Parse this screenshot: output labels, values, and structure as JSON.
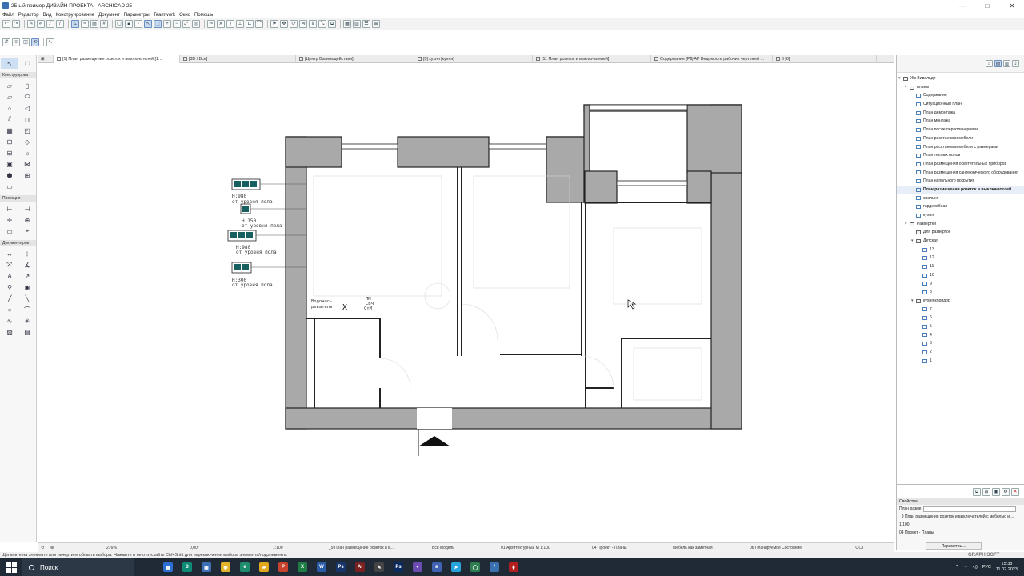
{
  "window": {
    "title": "25-ый пример ДИЗАЙН ПРОЕКТА - ARCHICAD 25",
    "minimize": "—",
    "maximize": "□",
    "close": "✕"
  },
  "menu": [
    "Файл",
    "Редактор",
    "Вид",
    "Конструирование",
    "Документ",
    "Параметры",
    "Teamwork",
    "Окно",
    "Помощь"
  ],
  "toolbox": {
    "section_design": "Конструирова",
    "section_view": "Проекция",
    "section_docs": "Документиров"
  },
  "tabs": [
    "[1] План размещения розеток и выключателей [1...",
    "[3D / Все]",
    "[Центр Взаимодействия]",
    "[0] кухня [кухня]",
    "[11 План розеток и выключателей]",
    "Содержание [РД-АР Ведомость рабочих чертежей ...",
    "6 [6]"
  ],
  "plan": {
    "socket_labels": [
      {
        "h": "H:980",
        "sub": "от уровня пола"
      },
      {
        "h": "H:150",
        "sub": "от уровня пола"
      },
      {
        "h": "H:980",
        "sub": "от уровня пола"
      },
      {
        "h": "H:300",
        "sub": "от уровня пола"
      }
    ],
    "heater_line1": "Водонаг-",
    "heater_line2": "реватель",
    "heater_mark": "X",
    "appliance_line1": "ПМ",
    "appliance_line2": "СВЧ",
    "appliance_line3": "СтМ"
  },
  "navigator": {
    "items": [
      {
        "label": "Жк Вивальди",
        "level": 0,
        "type": "root",
        "twisty": "▾"
      },
      {
        "label": "планы",
        "level": 1,
        "type": "folder",
        "twisty": "▾"
      },
      {
        "label": "Содержание",
        "level": 2,
        "type": "sheet"
      },
      {
        "label": "Ситуационный план",
        "level": 2,
        "type": "sheet"
      },
      {
        "label": "План демонтажа",
        "level": 2,
        "type": "sheet"
      },
      {
        "label": "План монтажа",
        "level": 2,
        "type": "sheet"
      },
      {
        "label": "План после перепланировки",
        "level": 2,
        "type": "sheet"
      },
      {
        "label": "План расстановки мебели",
        "level": 2,
        "type": "sheet"
      },
      {
        "label": "План расстановки мебели с размерами",
        "level": 2,
        "type": "sheet"
      },
      {
        "label": "План теплых полов",
        "level": 2,
        "type": "sheet"
      },
      {
        "label": "План размещения осветительных приборов",
        "level": 2,
        "type": "sheet"
      },
      {
        "label": "План размещения сантехнического оборудования",
        "level": 2,
        "type": "sheet"
      },
      {
        "label": "План напольного покрытия",
        "level": 2,
        "type": "sheet"
      },
      {
        "label": "План размещения розеток и выключателей",
        "level": 2,
        "type": "sheet",
        "selected": true
      },
      {
        "label": "спальня",
        "level": 2,
        "type": "sheet"
      },
      {
        "label": "гардеробная",
        "level": 2,
        "type": "sheet"
      },
      {
        "label": "кухня",
        "level": 2,
        "type": "sheet"
      },
      {
        "label": "Развертки",
        "level": 1,
        "type": "folder",
        "twisty": "▾"
      },
      {
        "label": "Для разверток",
        "level": 2,
        "type": "folder"
      },
      {
        "label": "Детская",
        "level": 2,
        "type": "folder",
        "twisty": "▾"
      },
      {
        "label": "13",
        "level": 3,
        "type": "sheet"
      },
      {
        "label": "12",
        "level": 3,
        "type": "sheet"
      },
      {
        "label": "11",
        "level": 3,
        "type": "sheet"
      },
      {
        "label": "10",
        "level": 3,
        "type": "sheet"
      },
      {
        "label": "9",
        "level": 3,
        "type": "sheet"
      },
      {
        "label": "8",
        "level": 3,
        "type": "sheet"
      },
      {
        "label": "кухня коридор",
        "level": 2,
        "type": "folder",
        "twisty": "▾"
      },
      {
        "label": "7",
        "level": 3,
        "type": "sheet"
      },
      {
        "label": "6",
        "level": 3,
        "type": "sheet"
      },
      {
        "label": "5",
        "level": 3,
        "type": "sheet"
      },
      {
        "label": "4",
        "level": 3,
        "type": "sheet"
      },
      {
        "label": "3",
        "level": 3,
        "type": "sheet"
      },
      {
        "label": "2",
        "level": 3,
        "type": "sheet"
      },
      {
        "label": "1",
        "level": 3,
        "type": "sheet"
      }
    ]
  },
  "properties": {
    "header": "Свойства",
    "field_label": "План разме",
    "field_value": "",
    "row1": "_9 План размещения розеток и выключателей с мебелью и ...",
    "row2": "1:100",
    "row3": "04 Проект - Планы",
    "button": "Параметры..."
  },
  "quick_options": {
    "zoom": "276%",
    "angle": "0,00°",
    "scale": "1:100",
    "view": "_9 План размещение розеток и в...",
    "model": "Вся Модель",
    "pen_set": "01 Архитектурный М 1:100",
    "model_view": "04 Проект - Планы",
    "override": "Мебель как заметная",
    "renovation": "06 Планируемое Состояние",
    "dim": "ГОСТ"
  },
  "status": {
    "hint": "Щелкните на элементе или начертите область выбора. Нажмите и не отпускайте Ctrl+Shift для переключения выбора элемента/подэлемента.",
    "brand": "GRAPHISOFT"
  },
  "taskbar": {
    "search": "Поиск",
    "lang": "РУС",
    "time": "15:38",
    "date": "11.02.2023"
  },
  "colors": {
    "wall": "#a9a9a9",
    "socket": "#17605f",
    "accent": "#3a6fb0"
  }
}
